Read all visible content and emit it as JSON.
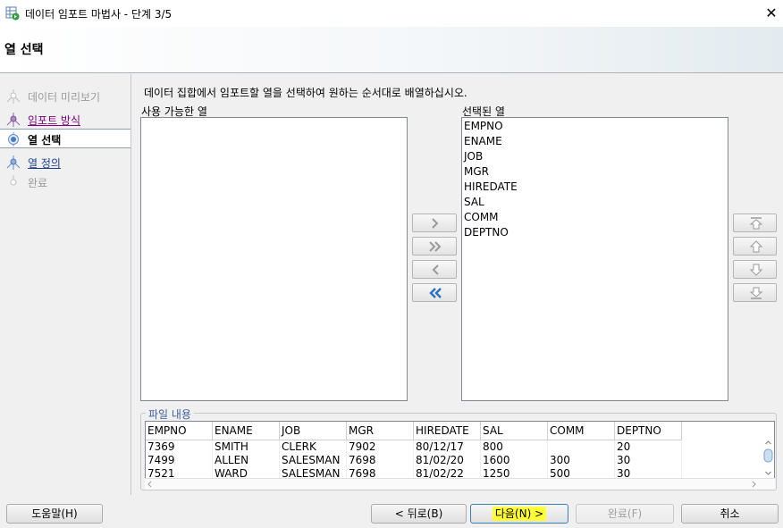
{
  "window": {
    "title": "데이터 임포트 마법사 - 단계 3/5"
  },
  "header": {
    "title": "열 선택"
  },
  "nav": {
    "items": [
      {
        "label": "데이터 미리보기",
        "state": "disabled"
      },
      {
        "label": "임포트 방식",
        "state": "visited"
      },
      {
        "label": "열 선택",
        "state": "current"
      },
      {
        "label": "열 정의",
        "state": "link"
      },
      {
        "label": "완료",
        "state": "disabled"
      }
    ]
  },
  "main": {
    "instruction": "데이터 집합에서 임포트할 열을 선택하여 원하는 순서대로 배열하십시오.",
    "available_label": "사용 가능한 열",
    "selected_label": "선택된 열",
    "available_columns": [],
    "selected_columns": [
      "EMPNO",
      "ENAME",
      "JOB",
      "MGR",
      "HIREDATE",
      "SAL",
      "COMM",
      "DEPTNO"
    ]
  },
  "file_content": {
    "legend": "파일 내용",
    "headers": [
      "EMPNO",
      "ENAME",
      "JOB",
      "MGR",
      "HIREDATE",
      "SAL",
      "COMM",
      "DEPTNO"
    ],
    "rows": [
      [
        "7369",
        "SMITH",
        "CLERK",
        "7902",
        "80/12/17",
        "800",
        "",
        "20"
      ],
      [
        "7499",
        "ALLEN",
        "SALESMAN",
        "7698",
        "81/02/20",
        "1600",
        "300",
        "30"
      ],
      [
        "7521",
        "WARD",
        "SALESMAN",
        "7698",
        "81/02/22",
        "1250",
        "500",
        "30"
      ]
    ]
  },
  "buttons": {
    "help": "도움말(H)",
    "back": "< 뒤로(B)",
    "next": "다음(N) >",
    "finish": "완료(F)",
    "cancel": "취소"
  },
  "colors": {
    "accent": "#1a3f8c",
    "visited": "#800080",
    "highlight": "#ffff33",
    "arrow_blue": "#2a6fbf"
  }
}
